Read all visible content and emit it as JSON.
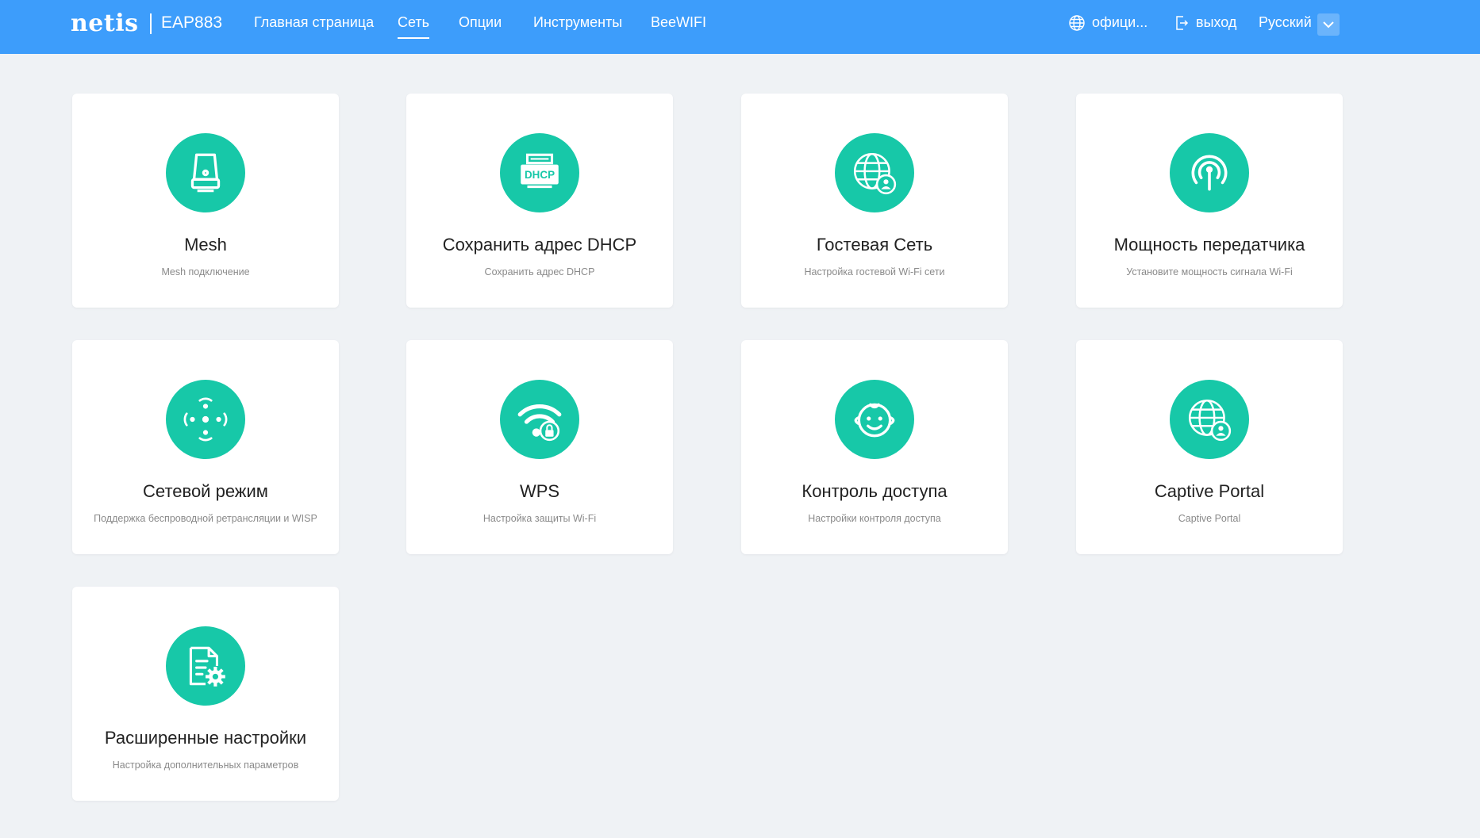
{
  "header": {
    "logo": "netis",
    "model": "EAP883",
    "nav": [
      "Главная страница",
      "Сеть",
      "Опции",
      "Инструменты",
      "BeeWIFI"
    ],
    "active_nav": "Сеть",
    "official": "офици...",
    "logout": "выход",
    "language": "Русский"
  },
  "cards": [
    {
      "title": "Mesh",
      "desc": "Mesh подключение",
      "icon": "mesh-device-icon"
    },
    {
      "title": "Сохранить адрес DHCP",
      "desc": "Сохранить адрес DHCP",
      "icon": "dhcp-icon"
    },
    {
      "title": "Гостевая Сеть",
      "desc": "Настройка гостевой Wi-Fi сети",
      "icon": "guest-network-globe-icon"
    },
    {
      "title": "Мощность передатчика",
      "desc": "Установите мощность сигнала Wi-Fi",
      "icon": "antenna-signal-icon"
    },
    {
      "title": "Сетевой режим",
      "desc": "Поддержка беспроводной ретрансляции и WISP",
      "icon": "network-mode-icon"
    },
    {
      "title": "WPS",
      "desc": "Настройка защиты Wi-Fi",
      "icon": "wifi-lock-icon"
    },
    {
      "title": "Контроль доступа",
      "desc": "Настройки контроля доступа",
      "icon": "child-face-icon"
    },
    {
      "title": "Captive Portal",
      "desc": "Captive Portal",
      "icon": "captive-portal-globe-icon"
    },
    {
      "title": "Расширенные настройки",
      "desc": "Настройка дополнительных параметров",
      "icon": "document-gear-icon"
    }
  ],
  "colors": {
    "header": "#3d9dfb",
    "icon_circle": "#17c8a8",
    "background": "#eff2f5"
  }
}
